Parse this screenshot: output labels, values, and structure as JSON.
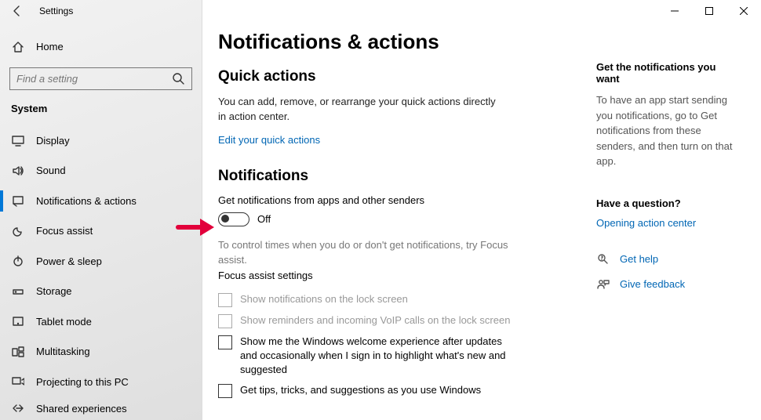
{
  "header": {
    "title": "Settings"
  },
  "home_label": "Home",
  "search_placeholder": "Find a setting",
  "section_label": "System",
  "sidebar": {
    "items": [
      {
        "label": "Display"
      },
      {
        "label": "Sound"
      },
      {
        "label": "Notifications & actions"
      },
      {
        "label": "Focus assist"
      },
      {
        "label": "Power & sleep"
      },
      {
        "label": "Storage"
      },
      {
        "label": "Tablet mode"
      },
      {
        "label": "Multitasking"
      },
      {
        "label": "Projecting to this PC"
      },
      {
        "label": "Shared experiences"
      }
    ]
  },
  "page": {
    "title": "Notifications & actions",
    "quick_heading": "Quick actions",
    "quick_body": "You can add, remove, or rearrange your quick actions directly in action center.",
    "edit_link": "Edit your quick actions",
    "notif_heading": "Notifications",
    "toggle_label": "Get notifications from apps and other senders",
    "toggle_state": "Off",
    "focus_body": "To control times when you do or don't get notifications, try Focus assist.",
    "focus_link": "Focus assist settings",
    "checks": [
      {
        "label": "Show notifications on the lock screen",
        "disabled": true
      },
      {
        "label": "Show reminders and incoming VoIP calls on the lock screen",
        "disabled": true
      },
      {
        "label": "Show me the Windows welcome experience after updates and occasionally when I sign in to highlight what's new and suggested",
        "disabled": false
      },
      {
        "label": "Get tips, tricks, and suggestions as you use Windows",
        "disabled": false
      }
    ]
  },
  "right": {
    "h1": "Get the notifications you want",
    "p1": "To have an app start sending you notifications, go to Get notifications from these senders, and then turn on that app.",
    "q_heading": "Have a question?",
    "q_link": "Opening action center",
    "help": "Get help",
    "feedback": "Give feedback"
  }
}
